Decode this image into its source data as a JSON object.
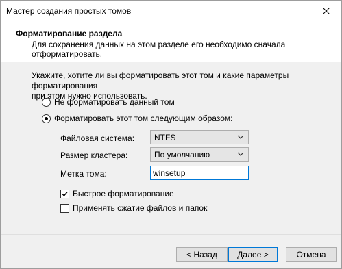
{
  "window": {
    "title": "Мастер создания простых томов"
  },
  "header": {
    "title": "Форматирование раздела",
    "desc_line1": "Для сохранения данных на этом разделе его необходимо сначала",
    "desc_line2": "отформатировать."
  },
  "main": {
    "instruction_line1": "Укажите, хотите ли вы форматировать этот том и какие параметры форматирования",
    "instruction_line2": "при этом нужно использовать.",
    "radio_no_format": {
      "label": "Не форматировать данный том",
      "checked": false
    },
    "radio_format": {
      "label": "Форматировать этот том следующим образом:",
      "checked": true
    },
    "filesystem": {
      "label": "Файловая система:",
      "value": "NTFS"
    },
    "cluster_size": {
      "label": "Размер кластера:",
      "value": "По умолчанию"
    },
    "volume_label": {
      "label": "Метка тома:",
      "value": "winsetup"
    },
    "quick_format": {
      "label": "Быстрое форматирование",
      "checked": true
    },
    "compression": {
      "label": "Применять сжатие файлов и папок",
      "checked": false
    }
  },
  "footer": {
    "back_label": "< Назад",
    "next_label": "Далее >",
    "cancel_label": "Отмена"
  },
  "colors": {
    "accent": "#0078d7",
    "background": "#f0f0f0",
    "header_bg": "#ffffff"
  }
}
